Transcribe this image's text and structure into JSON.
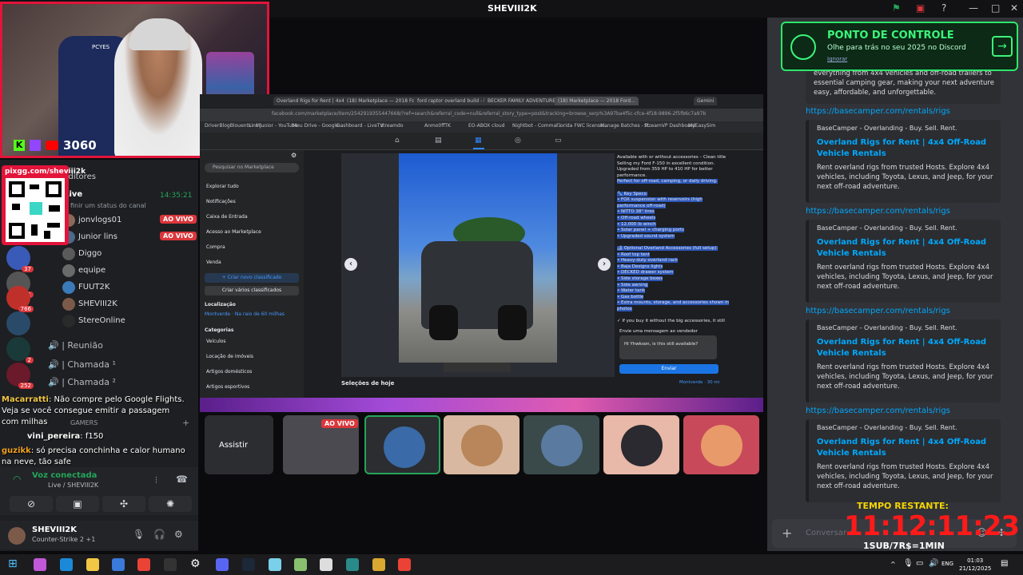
{
  "window": {
    "title": "SHEVIII2K"
  },
  "webcam": {
    "followers": "3060",
    "watermark": "sheviii2k",
    "chair_brand": "PCYES"
  },
  "qr": {
    "label": "pixgg.com/sheviii2k"
  },
  "discord_left": {
    "category_editores": "Editores",
    "channel_live": "Live",
    "channel_live_time": "14:35:21",
    "status_prompt": "finir um status do canal",
    "members": [
      {
        "name": "jonvlogs01",
        "live": "AO VIVO",
        "color": "#8a6a5a"
      },
      {
        "name": "Junior lins",
        "live": "AO VIVO",
        "color": "#4a6a8a"
      },
      {
        "name": "Diggo",
        "live": "",
        "color": "#5a5a5a"
      },
      {
        "name": "equipe",
        "live": "",
        "color": "#6a6a6a"
      },
      {
        "name": "FUUT2K",
        "live": "",
        "color": "#3a7ab8"
      },
      {
        "name": "SHEVIII2K",
        "live": "",
        "color": "#7c5a4a"
      },
      {
        "name": "StereOnline",
        "live": "",
        "color": "#2a2a2a"
      }
    ],
    "voice_channels": [
      "| Reunião",
      "| Chamada ¹",
      "| Chamada ²"
    ],
    "server_badges": [
      "37",
      "11",
      "766",
      "2",
      "252"
    ],
    "gamers_label": "GAMERS"
  },
  "chat_overlay": [
    {
      "user": "Macarratti",
      "text": ": Não compre pelo Google Flights. Veja se você consegue emitir a passagem com milhas"
    },
    {
      "user": "vini_pereira",
      "text": ": f150"
    },
    {
      "user": "guzikk",
      "text": ": só precisa conchinha e calor humano na neve, tão safe"
    }
  ],
  "voice": {
    "status": "Voz conectada",
    "channel": "Live / SHEVIII2K"
  },
  "user": {
    "name": "SHEVIII2K",
    "status": "Counter-Strike 2 +1"
  },
  "browser": {
    "tabs": [
      "Overland Rigs for Rent | 4x4 O...",
      "(18) Marketplace — 2018 Ford...",
      "ford raptor overland build - Pe...",
      "BECKER FAMILY ADVENTURES",
      "(18) Marketplace — 2018 Ford..."
    ],
    "gemini": "Gemini",
    "url": "facebook.com/marketplace/item/2542919355447668/?ref=search&referral_code=null&referral_story_type=post&tracking=browse_serp%3A97ba4f5c-cfce-4f18-9896-2f5fb6c7a97b",
    "bookmarks": [
      "DriverBlogBlouents - Mi...",
      "Lins Junior - YouTube",
      "Meu Drive - Google...",
      "Dashboard - LiveTV",
      "streamdo",
      "Anmo0ffTK",
      "EO-ABOX cloud",
      "Nightbot - Comma...",
      "Florida FWC license...",
      "Manage Batches - P...",
      "StreamVP Dashboard",
      "MyEasySim"
    ],
    "search_placeholder": "Pesquisar no Marketplace",
    "side_items": [
      "Explorar tudo",
      "Notificações",
      "Caixa de Entrada",
      "Acesso ao Marketplace",
      "Compra",
      "Venda"
    ],
    "btn_new": "+ Criar novo classificado",
    "btn_multi": "Criar vários classificados",
    "location_head": "Localização",
    "location_val": "Montverde · Na raio de 60 milhas",
    "categories_head": "Categorias",
    "categories": [
      "Veículos",
      "Locação de imóveis",
      "Artigos domésticos",
      "Artigos esportivos"
    ],
    "today": "Seleções de hoje",
    "description": [
      "Available with or without accessories – Clean title",
      "Selling my Ford F-150 in excellent condition.",
      "Upgraded from 359 HP to 410 HP for better",
      "performance.",
      "Perfect for off-road, camping, or daily driving.",
      "",
      "🔧 Key Specs:",
      "• FOX suspension with reservoirs (high",
      "performance off-road)",
      "• NITTO 38\" tires",
      "• Off-road wheels",
      "• 12,000 lb winch",
      "• Solar panel + charging ports",
      "• Upgraded sound system",
      "",
      "🏕 Optional Overland Accessories (full setup):",
      "• Roof top tent",
      "• Heavy-duty overland rack",
      "• Baja Designs lights",
      "• DECKED drawer system",
      "• Side storage boxes",
      "• Side awning",
      "• Water tank",
      "• Gas bottle",
      "• Extra mounts, storage, and accessories shown in",
      "photos",
      "",
      "✓ If you buy it without the big accessories, it still"
    ],
    "send_seller": "Envie uma mensagem ao vendedor",
    "message": "Hi Yhwkson, is this still available?",
    "send_btn": "Enviar",
    "location_footer": "Montverde · 30 mi"
  },
  "tiles": {
    "watch": "Assistir",
    "live": "AO VIVO"
  },
  "right_chat": {
    "banner_title": "PONTO DE CONTROLE",
    "banner_sub": "Olhe para trás no seu 2025 no Discord",
    "banner_link": "Ignorar",
    "top_desc": "everything from 4x4 vehicles and off-road trailers to essential camping gear, making your next adventure easy, affordable, and unforgettable.",
    "link": "https://basecamper.com/rentals/rigs",
    "provider": "BaseCamper - Overlanding - Buy. Sell. Rent.",
    "title": "Overland Rigs for Rent | 4x4 Off-Road Vehicle Rentals",
    "desc": "Rent overland rigs from trusted Hosts. Explore 4x4 vehicles, including Toyota, Lexus, and Jeep, for your next off-road adventure.",
    "input_placeholder": "Conversar e"
  },
  "timer": {
    "label": "TEMPO RESTANTE:",
    "value": "11:12:11:23",
    "rule": "1SUB/7R$=1MIN"
  },
  "taskbar": {
    "lang": "ENG",
    "time": "01:03",
    "date": "21/12/2025"
  }
}
